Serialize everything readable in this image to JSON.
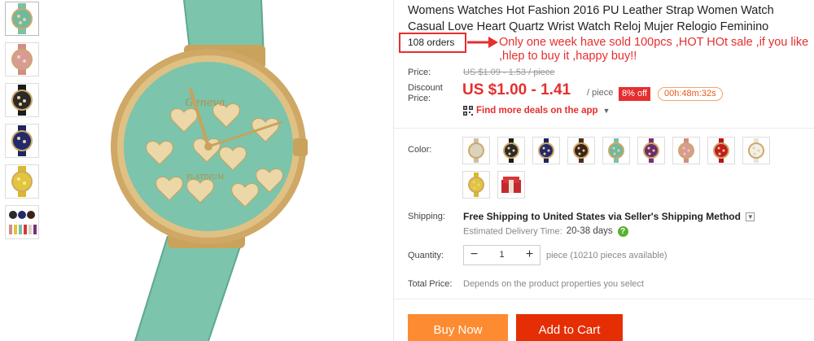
{
  "product": {
    "title": "Womens Watches Hot Fashion 2016 PU Leather Strap Women Watch Casual Love Heart Quartz Wrist Watch Reloj Mujer Relogio Feminino",
    "orders": "108 orders",
    "promo_note": "Only one week have sold 100pcs ,HOT HOt sale ,if you like ,hlep to buy it ,happy buy!!",
    "watch_brand": "Geneva",
    "watch_subtext": "PLATINUM"
  },
  "price": {
    "label": "Price:",
    "original": "US $1.09 - 1.53 / piece",
    "discount_label_1": "Discount",
    "discount_label_2": "Price:",
    "discount": "US $1.00 - 1.41",
    "unit": "/ piece",
    "off": "8% off",
    "timer": "00h:48m:32s",
    "deals_link": "Find more deals on the app"
  },
  "color": {
    "label": "Color:",
    "swatches": [
      {
        "name": "beige",
        "dial": "#d9d3c3",
        "strap": "#cdbfa6"
      },
      {
        "name": "black",
        "dial": "#2a2a2a",
        "strap": "#1b1b1b"
      },
      {
        "name": "blue",
        "dial": "#222a6b",
        "strap": "#1e2560"
      },
      {
        "name": "brown",
        "dial": "#3a2418",
        "strap": "#4a2d1f"
      },
      {
        "name": "green",
        "dial": "#6fb9a0",
        "strap": "#79c2a8"
      },
      {
        "name": "purple",
        "dial": "#6b2c6d",
        "strap": "#7a2f78"
      },
      {
        "name": "pink",
        "dial": "#d99a98",
        "strap": "#d18d8a"
      },
      {
        "name": "red",
        "dial": "#c21d1d",
        "strap": "#b3171a"
      },
      {
        "name": "white",
        "dial": "#f1efe9",
        "strap": "#e6e3da"
      },
      {
        "name": "yellow",
        "dial": "#e3c53b",
        "strap": "#d9b82e"
      },
      {
        "name": "box",
        "dial": "#d8353a",
        "strap": "#c22a30"
      }
    ]
  },
  "shipping": {
    "label": "Shipping:",
    "free": "Free Shipping",
    "to": "to",
    "country": "United States",
    "via": "via",
    "method": "Seller's Shipping Method",
    "est_label": "Estimated Delivery Time:",
    "est_days": "20-38 days"
  },
  "quantity": {
    "label": "Quantity:",
    "value": "1",
    "minus": "−",
    "plus": "+",
    "note": "piece (10210 pieces available)"
  },
  "total": {
    "label": "Total Price:",
    "note": "Depends on the product properties you select"
  },
  "actions": {
    "buy_now": "Buy Now",
    "add_to_cart": "Add to Cart"
  },
  "colors": {
    "accent_red": "#e62e2e",
    "buy_orange": "#fd8b32",
    "cart_red": "#e62e04",
    "watch_teal": "#7cc4ac",
    "gold": "#cfa866"
  }
}
